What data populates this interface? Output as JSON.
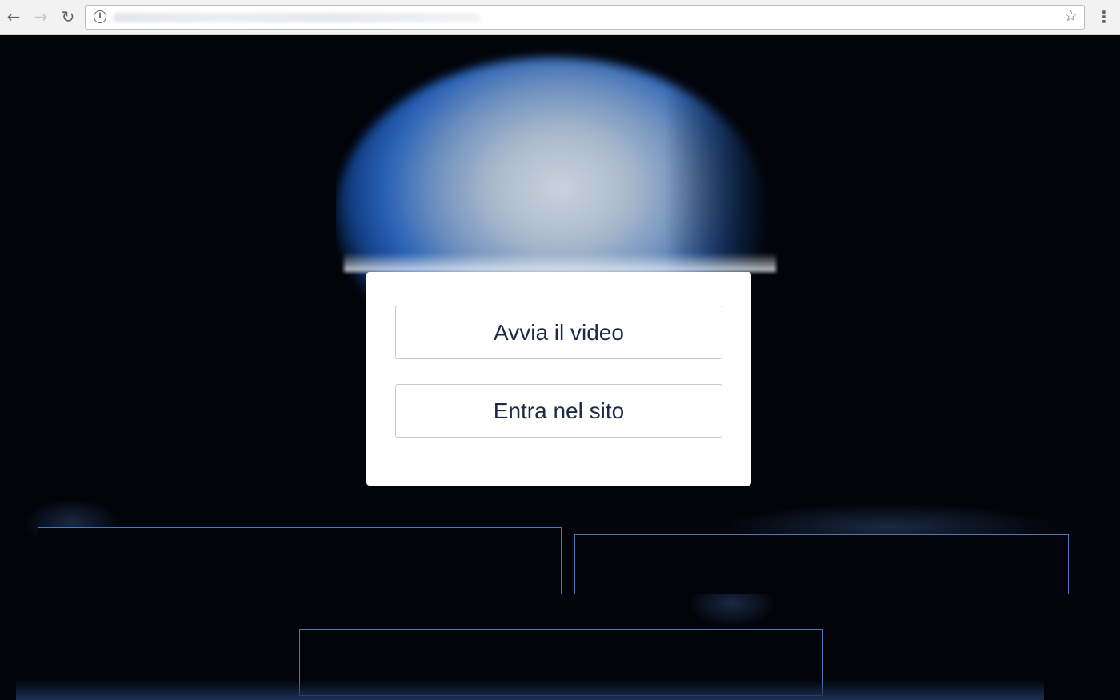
{
  "browser": {
    "back_label": "←",
    "forward_label": "→",
    "reload_label": "↻",
    "info_label": "i",
    "bookmark_label": "☆",
    "menu_label": "⋮",
    "icons": {
      "back": "arrow-left-icon",
      "forward": "arrow-right-icon",
      "reload": "reload-icon",
      "info": "info-icon",
      "bookmark": "star-icon",
      "menu": "vertical-dots-icon"
    }
  },
  "modal": {
    "play_video_label": "Avvia il video",
    "enter_site_label": "Entra nel sito"
  },
  "colors": {
    "page_background": "#02040a",
    "accent_blue": "#2a62b6",
    "outline_box_border": "#4a77b8",
    "button_text": "#1c2a46"
  }
}
